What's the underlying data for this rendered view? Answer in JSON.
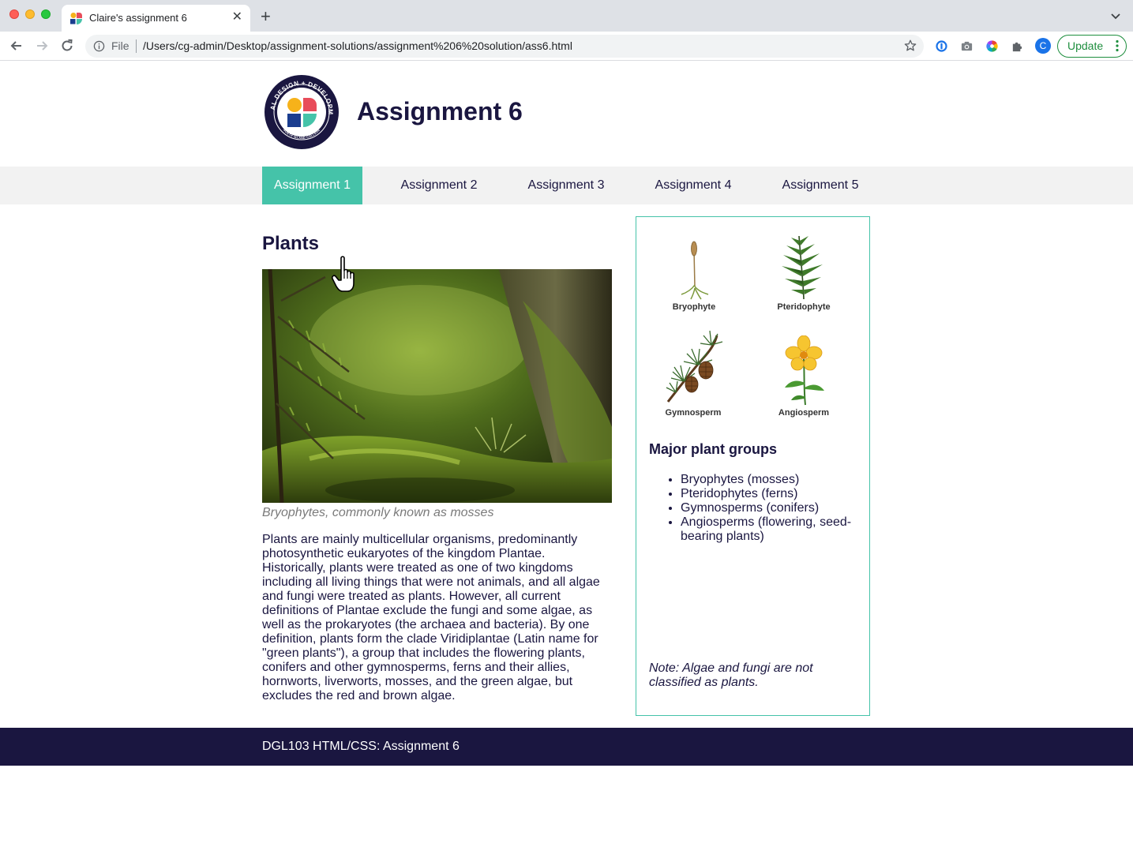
{
  "browser": {
    "tab_title": "Claire's assignment 6",
    "new_tab_symbol": "+",
    "close_symbol": "✕",
    "file_label": "File",
    "url": "/Users/cg-admin/Desktop/assignment-solutions/assignment%206%20solution/ass6.html",
    "profile_initial": "C",
    "update_label": "Update",
    "icons": [
      "back-icon",
      "forward-icon",
      "reload-icon",
      "info-icon",
      "star-icon",
      "password-manager-icon",
      "camera-icon",
      "color-wheel-icon",
      "extensions-icon",
      "more-icon"
    ]
  },
  "site": {
    "title": "Assignment 6",
    "logo_text": "DIGITAL DESIGN + DEVELOPMENT",
    "logo_subtext": "NORTH ISLAND COLLEGE"
  },
  "nav": {
    "items": [
      {
        "label": "Assignment 1",
        "active": true
      },
      {
        "label": "Assignment 2",
        "active": false
      },
      {
        "label": "Assignment 3",
        "active": false
      },
      {
        "label": "Assignment 4",
        "active": false
      },
      {
        "label": "Assignment 5",
        "active": false
      }
    ]
  },
  "main": {
    "heading": "Plants",
    "caption": "Bryophytes, commonly known as mosses",
    "paragraph": "Plants are mainly multicellular organisms, predominantly photosynthetic eukaryotes of the kingdom Plantae. Historically, plants were treated as one of two kingdoms including all living things that were not animals, and all algae and fungi were treated as plants. However, all current definitions of Plantae exclude the fungi and some algae, as well as the prokaryotes (the archaea and bacteria). By one definition, plants form the clade Viridiplantae (Latin name for \"green plants\"), a group that includes the flowering plants, conifers and other gymnosperms, ferns and their allies, hornworts, liverworts, mosses, and the green algae, but excludes the red and brown algae."
  },
  "aside": {
    "plants": [
      {
        "label": "Bryophyte"
      },
      {
        "label": "Pteridophyte"
      },
      {
        "label": "Gymnosperm"
      },
      {
        "label": "Angiosperm"
      }
    ],
    "heading": "Major plant groups",
    "groups": [
      "Bryophytes (mosses)",
      "Pteridophytes (ferns)",
      "Gymnosperms (conifers)",
      "Angiosperms (flowering, seed-bearing plants)"
    ],
    "note": "Note: Algae and fungi are not classified as plants."
  },
  "footer": {
    "text": "DGL103 HTML/CSS: Assignment 6"
  },
  "colors": {
    "accent": "#45c3a9",
    "navy": "#1a1640",
    "nav_bg": "#f2f2f2"
  }
}
